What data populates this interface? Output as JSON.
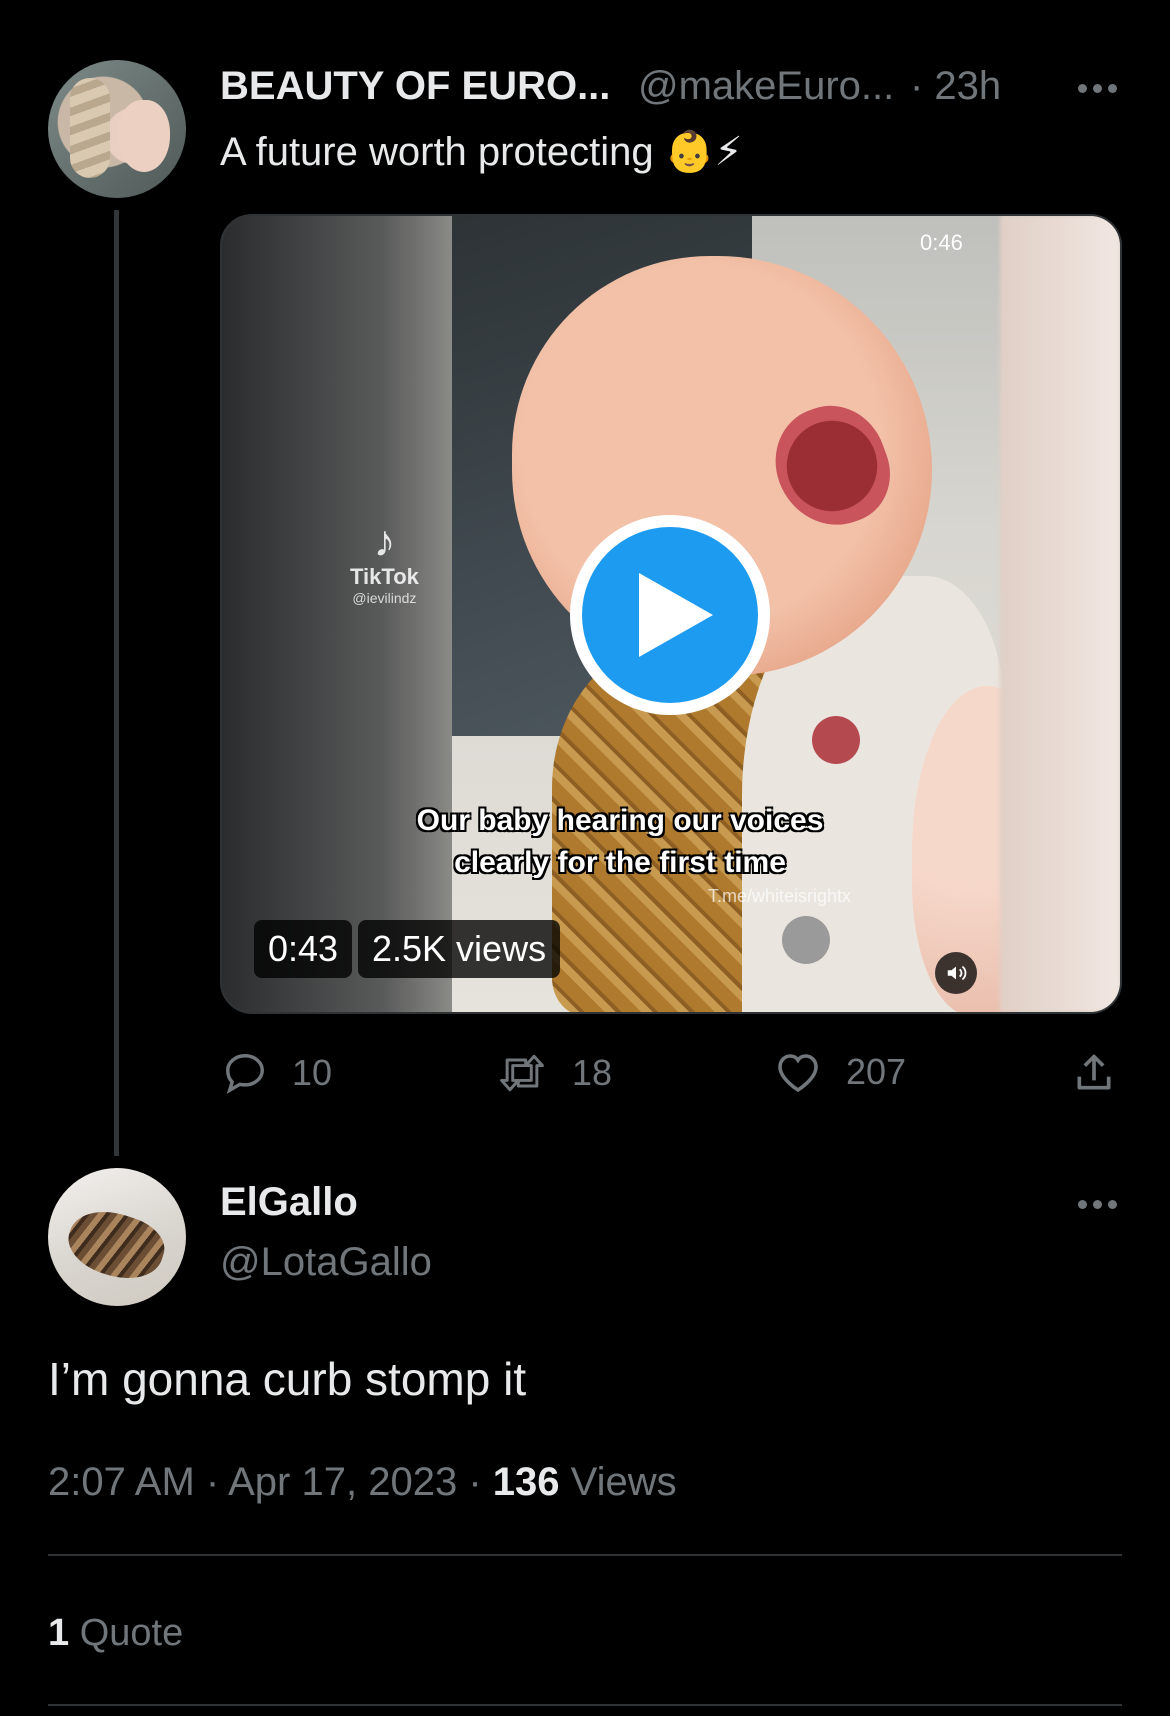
{
  "parent_tweet": {
    "display_name": "BEAUTY OF EURO...",
    "handle": "@makeEuro...",
    "time": "· 23h",
    "text": "A future worth protecting",
    "emoji": "👶⚡",
    "media": {
      "duration_top": "0:46",
      "timestamp_badge": "0:43",
      "views_badge": "2.5K views",
      "overlay_brand": "TikTok",
      "overlay_handle": "@ievilindz",
      "overlay_caption": "Our baby hearing our voices clearly for the first time",
      "overlay_watermark": "T.me/whiteisrightx"
    },
    "actions": {
      "replies": "10",
      "retweets": "18",
      "likes": "207"
    }
  },
  "reply_tweet": {
    "display_name": "ElGallo",
    "handle": "@LotaGallo",
    "text": "I’m gonna curb stomp it",
    "time": "2:07 AM",
    "date": "Apr 17, 2023",
    "views_count": "136",
    "views_label": "Views",
    "quotes_count": "1",
    "quotes_label": "Quote"
  },
  "colors": {
    "background": "#000000",
    "text": "#e7e9ea",
    "muted": "#71767b",
    "accent": "#1d9bf0",
    "divider": "#2f3336"
  },
  "icons": [
    "more-icon",
    "play-icon",
    "volume-icon",
    "reply-icon",
    "retweet-icon",
    "like-icon",
    "share-icon"
  ]
}
